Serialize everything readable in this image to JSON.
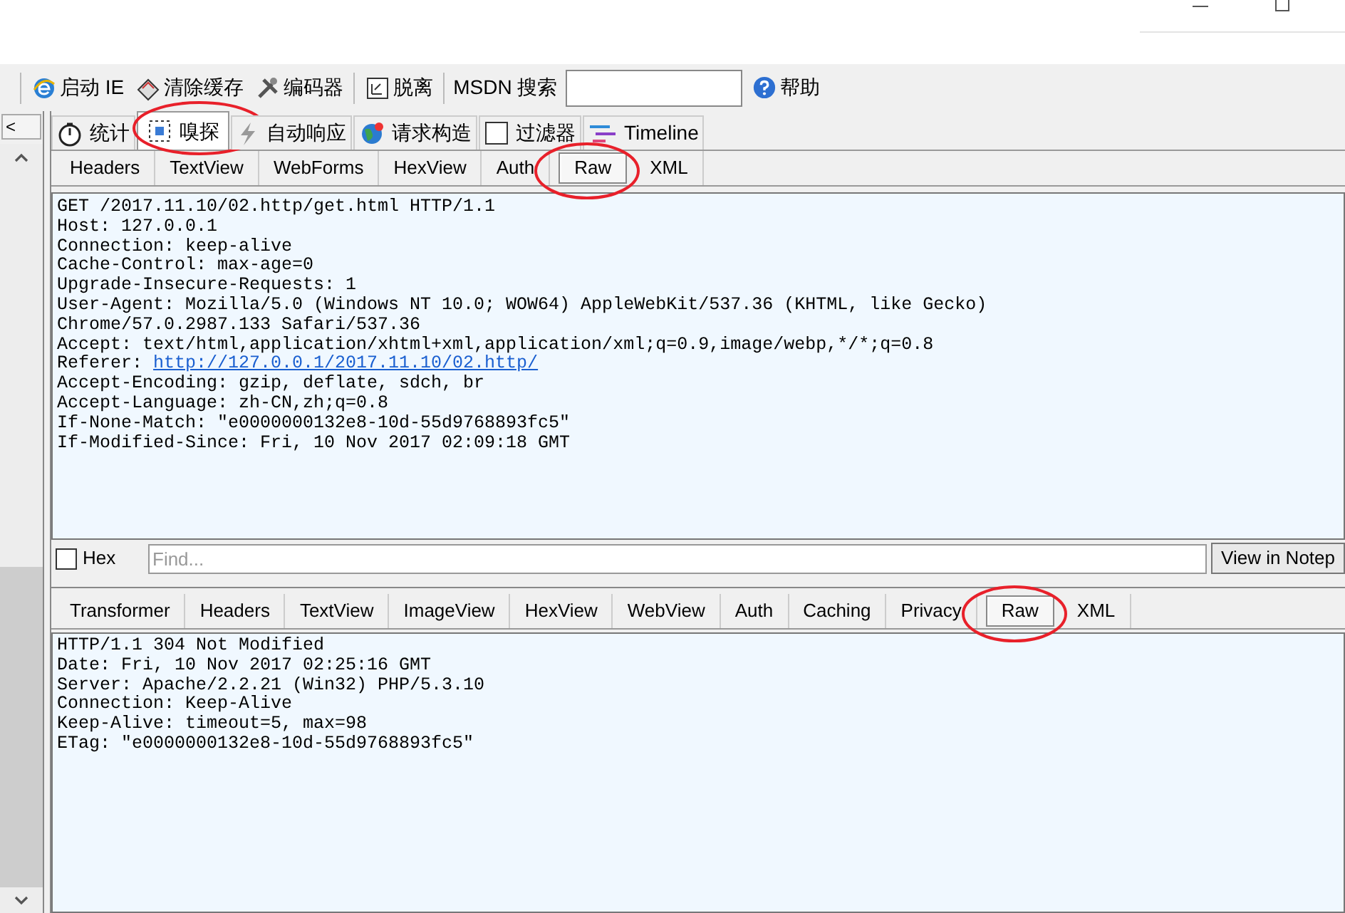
{
  "toolbar": {
    "items": [
      {
        "kind": "ie",
        "label": "启动 IE"
      },
      {
        "kind": "eraser",
        "label": "清除缓存"
      },
      {
        "kind": "tools",
        "label": "编码器"
      },
      {
        "kind": "detach",
        "label": "脱离"
      },
      {
        "kind": "text",
        "label": "MSDN 搜索"
      },
      {
        "kind": "input"
      },
      {
        "kind": "help",
        "label": "帮助"
      }
    ]
  },
  "left_panel": {
    "collapse_label": "<"
  },
  "main_tabs": [
    {
      "label": "统计",
      "kind": "clock",
      "selected": false
    },
    {
      "label": "嗅探",
      "kind": "dots",
      "selected": true
    },
    {
      "label": "自动响应",
      "kind": "bolt",
      "selected": false
    },
    {
      "label": "请求构造",
      "kind": "globe",
      "selected": false
    },
    {
      "label": "过滤器",
      "kind": "check",
      "selected": false
    },
    {
      "label": "Timeline",
      "kind": "lines",
      "selected": false
    }
  ],
  "request": {
    "tabs": [
      {
        "label": "Headers",
        "selected": false
      },
      {
        "label": "TextView",
        "selected": false
      },
      {
        "label": "WebForms",
        "selected": false
      },
      {
        "label": "HexView",
        "selected": false
      },
      {
        "label": "Auth",
        "selected": false
      },
      {
        "label": "Raw",
        "selected": true
      },
      {
        "label": "XML",
        "selected": false
      }
    ],
    "lines": [
      {
        "text": "GET /2017.11.10/02.http/get.html HTTP/1.1"
      },
      {
        "text": "Host: 127.0.0.1"
      },
      {
        "text": "Connection: keep-alive"
      },
      {
        "text": "Cache-Control: max-age=0"
      },
      {
        "text": "Upgrade-Insecure-Requests: 1"
      },
      {
        "text": "User-Agent: Mozilla/5.0 (Windows NT 10.0; WOW64) AppleWebKit/537.36 (KHTML, like Gecko)"
      },
      {
        "text": "Chrome/57.0.2987.133 Safari/537.36"
      },
      {
        "text": "Accept: text/html,application/xhtml+xml,application/xml;q=0.9,image/webp,*/*;q=0.8"
      },
      {
        "text": "Referer: ",
        "link": "http://127.0.0.1/2017.11.10/02.http/"
      },
      {
        "text": "Accept-Encoding: gzip, deflate, sdch, br"
      },
      {
        "text": "Accept-Language: zh-CN,zh;q=0.8"
      },
      {
        "text": "If-None-Match: \"e0000000132e8-10d-55d9768893fc5\""
      },
      {
        "text": "If-Modified-Since: Fri, 10 Nov 2017 02:09:18 GMT"
      }
    ],
    "find_bar": {
      "hex_label": "Hex",
      "hex_checked": false,
      "placeholder": "Find...",
      "button": "View in Notep"
    }
  },
  "response": {
    "tabs": [
      {
        "label": "Transformer",
        "selected": false
      },
      {
        "label": "Headers",
        "selected": false
      },
      {
        "label": "TextView",
        "selected": false
      },
      {
        "label": "ImageView",
        "selected": false
      },
      {
        "label": "HexView",
        "selected": false
      },
      {
        "label": "WebView",
        "selected": false
      },
      {
        "label": "Auth",
        "selected": false
      },
      {
        "label": "Caching",
        "selected": false
      },
      {
        "label": "Privacy",
        "selected": false
      },
      {
        "label": "Raw",
        "selected": true
      },
      {
        "label": "XML",
        "selected": false
      }
    ],
    "lines": [
      {
        "text": "HTTP/1.1 304 Not Modified"
      },
      {
        "text": "Date: Fri, 10 Nov 2017 02:25:16 GMT"
      },
      {
        "text": "Server: Apache/2.2.21 (Win32) PHP/5.3.10"
      },
      {
        "text": "Connection: Keep-Alive"
      },
      {
        "text": "Keep-Alive: timeout=5, max=98"
      },
      {
        "text": "ETag: \"e0000000132e8-10d-55d9768893fc5\""
      }
    ]
  }
}
